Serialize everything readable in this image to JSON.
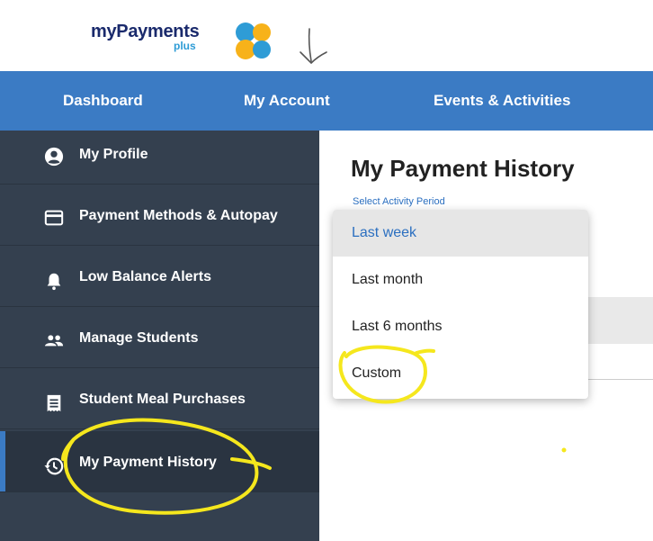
{
  "brand": {
    "name": "myPayments",
    "sub": "plus"
  },
  "topnav": {
    "items": [
      "Dashboard",
      "My Account",
      "Events & Activities"
    ]
  },
  "sidebar": {
    "items": [
      {
        "label": "My Profile",
        "icon": "account-circle-icon"
      },
      {
        "label": "Payment Methods & Autopay",
        "icon": "credit-card-icon"
      },
      {
        "label": "Low Balance Alerts",
        "icon": "bell-icon"
      },
      {
        "label": "Manage Students",
        "icon": "people-icon"
      },
      {
        "label": "Student Meal Purchases",
        "icon": "receipt-icon"
      },
      {
        "label": "My Payment History",
        "icon": "history-icon",
        "active": true
      }
    ]
  },
  "main": {
    "title": "My Payment History",
    "period_label": "Select Activity Period",
    "period_options": [
      "Last week",
      "Last month",
      "Last 6 months",
      "Custom"
    ],
    "selected_option": "Last week"
  },
  "colors": {
    "nav_blue": "#3b7bc4",
    "sidebar": "#34404f",
    "highlight": "#f5e71d"
  }
}
